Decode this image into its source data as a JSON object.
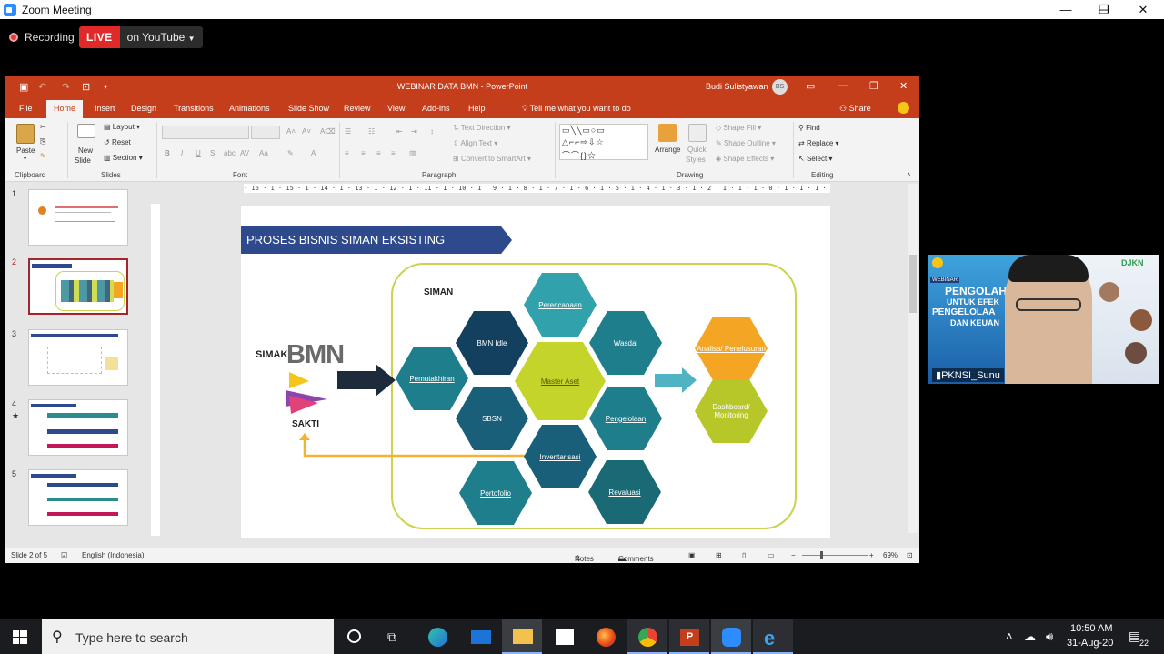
{
  "zoom": {
    "window_title": "Zoom Meeting",
    "recording_label": "Recording",
    "live_badge": "LIVE",
    "live_destination": "on YouTube"
  },
  "ppt": {
    "doc_title": "WEBINAR DATA BMN  -  PowerPoint",
    "user_name": "Budi Sulistyawan",
    "user_initials": "BS",
    "tabs": [
      "File",
      "Home",
      "Insert",
      "Design",
      "Transitions",
      "Animations",
      "Slide Show",
      "Review",
      "View",
      "Add-ins",
      "Help"
    ],
    "active_tab": "Home",
    "tell_me": "Tell me what you want to do",
    "share": "Share",
    "ribbon": {
      "paste": "Paste",
      "new_slide": "New",
      "new_slide_2": "Slide",
      "layout": "Layout",
      "reset": "Reset",
      "section": "Section",
      "text_direction": "Text Direction",
      "align_text": "Align Text",
      "convert_smartart": "Convert to SmartArt",
      "arrange": "Arrange",
      "quick_styles": "Quick",
      "quick_styles_2": "Styles",
      "shape_fill": "Shape Fill",
      "shape_outline": "Shape Outline",
      "shape_effects": "Shape Effects",
      "find": "Find",
      "replace": "Replace",
      "select": "Select",
      "groups": [
        "Clipboard",
        "Slides",
        "Font",
        "Paragraph",
        "Drawing",
        "Editing"
      ]
    },
    "ruler_text": "· 16 · 1 · 15 · 1 · 14 · 1 · 13 · 1 · 12 · 1 · 11 · 1 · 10 · 1 · 9 · 1 · 8 · 1 · 7 · 1 · 6 · 1 · 5 · 1 · 4 · 1 · 3 · 1 · 2 · 1 · 1 · 1 · 0 · 1 · 1 · 1 · 2 · 1 · 3 · 1 · 4 · 1 · 5 · 1 · 6 · 1 · 7 · 1 · 8 · 1 · 9 · 1 · 10 · 1 · 11 · 1 · 12 · 1 · 13 · 1 · 14 · 1 · 15 · 1 · 16 ·",
    "slide_numbers": [
      "1",
      "2",
      "3",
      "4",
      "5"
    ],
    "thumb_star": "★",
    "slide": {
      "title": "PROSES BISNIS SIMAN EKSISTING",
      "siman": "SIMAN",
      "simak": "SIMAK",
      "bmn": "BMN",
      "sakti": "SAKTI",
      "hexes": {
        "pemutakhiran": "Pemutakhiran",
        "perencanaan": "Perencanaan",
        "bmn_idle": "BMN Idle",
        "wasdal": "Wasdal",
        "master_aset": "Master Aset",
        "sbsn": "SBSN",
        "pengelolaan": "Pengelolaan",
        "inventarisasi": "Inventarisasi",
        "portofolio": "Portofolio",
        "revaluasi": "Revaluasi",
        "analisa": "Analisa/ Penelusuran",
        "dashboard": "Dashboard/ Monitoring"
      }
    },
    "status": {
      "slide_of": "Slide 2 of 5",
      "language": "English (Indonesia)",
      "notes": "Notes",
      "comments": "Comments",
      "zoom": "69%"
    }
  },
  "webcam": {
    "name": "PKNSI_Sunu",
    "banner_1": "PENGOLAH",
    "banner_2": "UNTUK EFEK",
    "banner_3": "PENGELOLAA",
    "banner_4": "DAN KEUAN",
    "tag": "WEBINAR",
    "logo": "DJKN"
  },
  "taskbar": {
    "search_placeholder": "Type here to search",
    "time": "10:50 AM",
    "date": "31-Aug-20",
    "notif_count": "22"
  },
  "colors": {
    "ppt_red": "#c43e1c",
    "live_red": "#e02a2a",
    "hex_teal": "#1f7e8c",
    "hex_dark": "#14405f",
    "hex_yellow": "#c5d42a",
    "hex_orange": "#f5a524"
  }
}
